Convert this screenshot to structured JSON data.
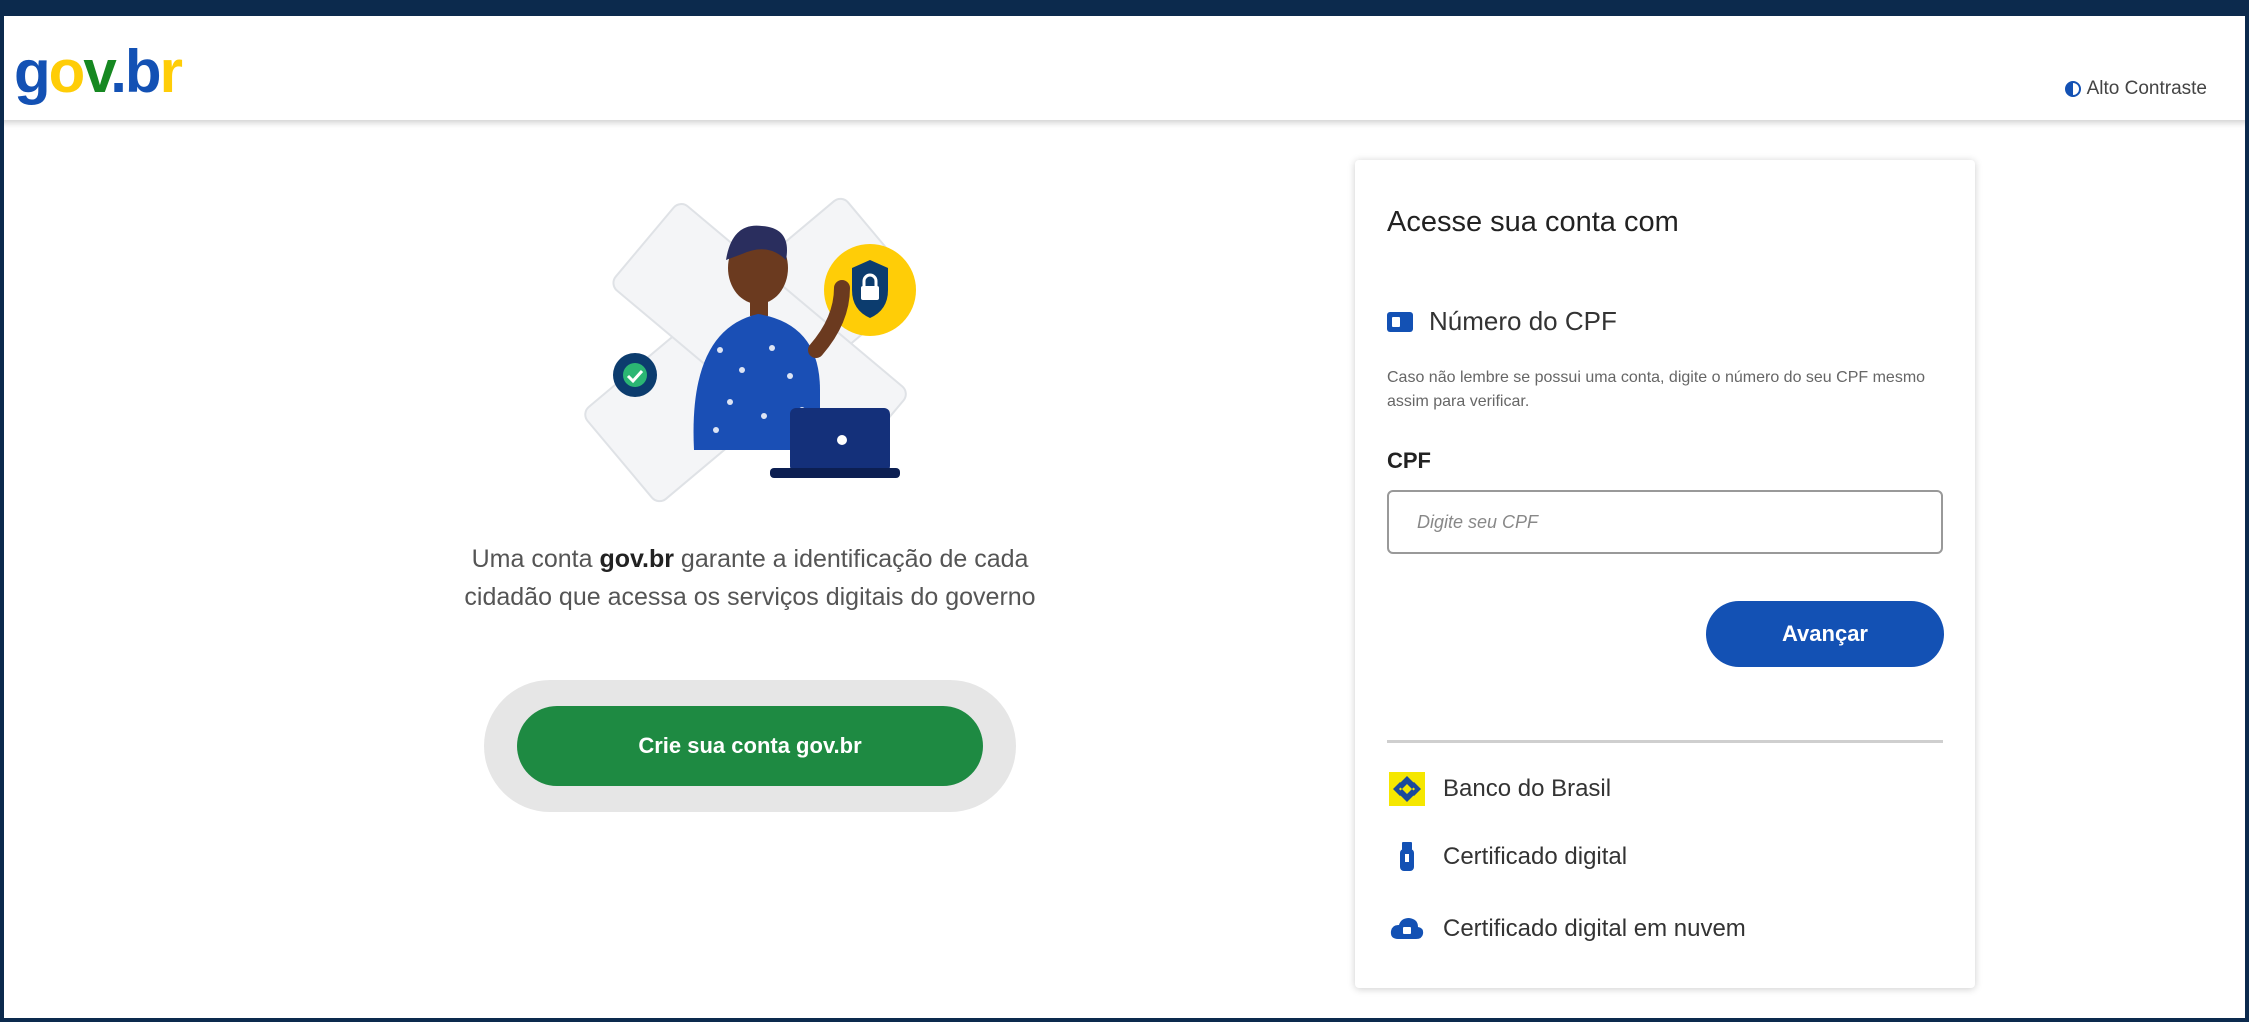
{
  "header": {
    "logo_parts": {
      "g": "g",
      "o": "o",
      "v": "v",
      "dot": ".",
      "b": "b",
      "r": "r"
    },
    "contrast_label": "Alto Contraste"
  },
  "left": {
    "description_prefix": "Uma conta ",
    "description_brand": "gov.br",
    "description_line1_rest": " garante a identificação de cada",
    "description_line2": "cidadão que acessa os serviços digitais do governo",
    "create_button_label": "Crie sua conta gov.br"
  },
  "card": {
    "title": "Acesse sua conta com",
    "cpf_option_label": "Número do CPF",
    "cpf_hint": "Caso não lembre se possui uma conta, digite o número do seu CPF mesmo assim para verificar.",
    "cpf_label": "CPF",
    "cpf_placeholder": "Digite seu CPF",
    "cpf_value": "",
    "next_button_label": "Avançar",
    "alternatives": [
      {
        "label": "Banco do Brasil",
        "icon": "banco-do-brasil-icon"
      },
      {
        "label": "Certificado digital",
        "icon": "usb-token-icon"
      },
      {
        "label": "Certificado digital em nuvem",
        "icon": "cloud-icon"
      }
    ]
  },
  "colors": {
    "brand_blue": "#1351b4",
    "brand_yellow": "#ffcd07",
    "brand_green": "#168821",
    "cta_green": "#1e8a42",
    "frame_navy": "#0c2a4d"
  }
}
